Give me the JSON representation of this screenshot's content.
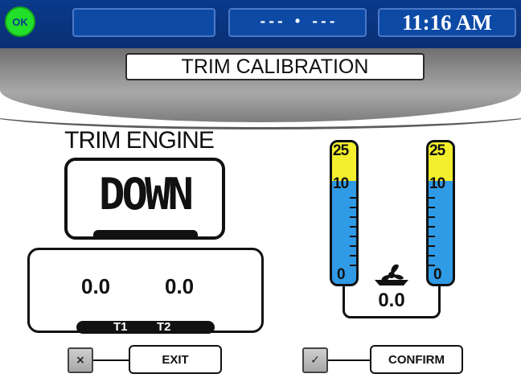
{
  "status_bar": {
    "status_indicator": "OK",
    "center_display": "--- • ---",
    "clock": "11:16 AM",
    "colors": {
      "bar": "#0a3a8c",
      "ok": "#22e02a"
    }
  },
  "header": {
    "title": "TRIM CALIBRATION"
  },
  "trim_engine": {
    "label": "TRIM ENGINE",
    "direction": "DOWN"
  },
  "readout": {
    "t1_value": "0.0",
    "t2_value": "0.0",
    "t1_label": "T1",
    "t2_label": "T2"
  },
  "gauges": {
    "left": {
      "top_label": "25",
      "mid_label": "10",
      "bottom_label": "0"
    },
    "right": {
      "top_label": "25",
      "mid_label": "10",
      "bottom_label": "0"
    },
    "colors": {
      "upper": "#f3ef2c",
      "lower": "#2f9ae6"
    },
    "angle_value": "0.0",
    "center_icon": "propeller-icon"
  },
  "buttons": {
    "exit": {
      "icon_glyph": "×",
      "label": "EXIT"
    },
    "confirm": {
      "icon_glyph": "✓",
      "label": "CONFIRM"
    }
  }
}
